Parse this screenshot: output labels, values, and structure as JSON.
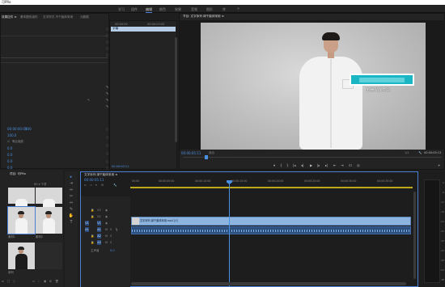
{
  "window": {
    "title": "可PRo"
  },
  "workspaces": [
    {
      "label": "学习",
      "active": false
    },
    {
      "label": "组件",
      "active": false
    },
    {
      "label": "编辑",
      "active": true
    },
    {
      "label": "颜色",
      "active": false
    },
    {
      "label": "效果",
      "active": false
    },
    {
      "label": "音频",
      "active": false
    },
    {
      "label": "图形",
      "active": false
    },
    {
      "label": "库",
      "active": false
    }
  ],
  "workspace_more": "»",
  "source_panel": {
    "tabs": [
      "效果控件 ≡",
      "基本图形组件",
      "文字样式 不千脑体采用",
      "元数据"
    ],
    "labels": {
      "position": "00:00:00:00",
      "value_a": "100.0",
      "value_b": "100",
      "checkbox": "等比缩放",
      "zero": "0.0",
      "v1": "0.0",
      "v2": "0.0",
      "v3": "0.0"
    }
  },
  "effects_list": {
    "header_left": "00:00:00",
    "header_right": "00:00:03:00",
    "selected_item": "字幕",
    "timecode": "00:00:00:11"
  },
  "program_monitor": {
    "tab": "节目: 文字序列 绿千脑体采用 ≡",
    "overlay_caption": "天津传媒学院",
    "timecode_left": "00:00:05:11",
    "fit_label": "适合",
    "quality_label": "1/2",
    "timecode_right": "00:00:05:13",
    "controls": [
      "▾",
      "{",
      "}",
      "|◂",
      "◂|",
      "▶",
      "|▸",
      "▸|",
      "⇤",
      "⇥",
      "⊡",
      "◎",
      "+"
    ]
  },
  "project_panel": {
    "tab": "项目: 可PRo",
    "search_placeholder": "",
    "count_label": "60 ▾ 个项",
    "items": [
      {
        "label": "",
        "dark": false
      },
      {
        "label": "",
        "dark": false
      },
      {
        "label": "素材1",
        "dark": false
      },
      {
        "label": "素材2",
        "dark": false
      },
      {
        "label": "序列",
        "dark": true
      },
      {
        "label": "",
        "dark": false
      }
    ],
    "footer_icons": [
      "≡",
      "□",
      "○",
      "▭",
      "⌕",
      "▣",
      "⊞",
      "🗑"
    ]
  },
  "tools": [
    {
      "name": "selection-tool",
      "glyph": "▸",
      "active": true
    },
    {
      "name": "track-select-tool",
      "glyph": "⇥",
      "active": false
    },
    {
      "name": "ripple-tool",
      "glyph": "⇔",
      "active": false
    },
    {
      "name": "razor-tool",
      "glyph": "✂",
      "active": false
    },
    {
      "name": "slip-tool",
      "glyph": "↔",
      "active": false
    },
    {
      "name": "pen-tool",
      "glyph": "✎",
      "active": false
    },
    {
      "name": "hand-tool",
      "glyph": "✋",
      "active": false
    },
    {
      "name": "type-tool",
      "glyph": "T",
      "active": false
    }
  ],
  "timeline": {
    "tab": "文字序列 绿千脑体采用 ≡",
    "timecode": "00:00:05:11",
    "ruler": [
      "00:00",
      "00:00:05:00",
      "00:00:10:00",
      "00:00:15:00",
      "00:00:20:00",
      "00:00:25:00",
      "00:00:30:00",
      "00:00:35:00"
    ],
    "tracks": [
      {
        "id": "V3",
        "btn": "V3"
      },
      {
        "id": "V2",
        "btn": "V2"
      },
      {
        "id": "V1",
        "btn": "V1"
      },
      {
        "id": "A1",
        "btn": "A1"
      },
      {
        "id": "A2",
        "btn": "A2"
      },
      {
        "id": "A3",
        "btn": "A3"
      }
    ],
    "master_label": "主声道",
    "master_value": "0.0",
    "video_clip_label": "文字序列 绿千脑体采用.mp4 [V]"
  },
  "meter": {
    "ticks": [
      "0",
      "-6",
      "-12",
      "-18",
      "-24",
      "-30",
      "-36",
      "-42",
      "-48",
      "-54",
      "dB"
    ]
  },
  "colors": {
    "accent": "#4a90e2",
    "panel_bg": "#232323",
    "overlay_box": "#1ab6c4",
    "clip_video": "#8db4de",
    "clip_audio": "#2c4f7d"
  }
}
